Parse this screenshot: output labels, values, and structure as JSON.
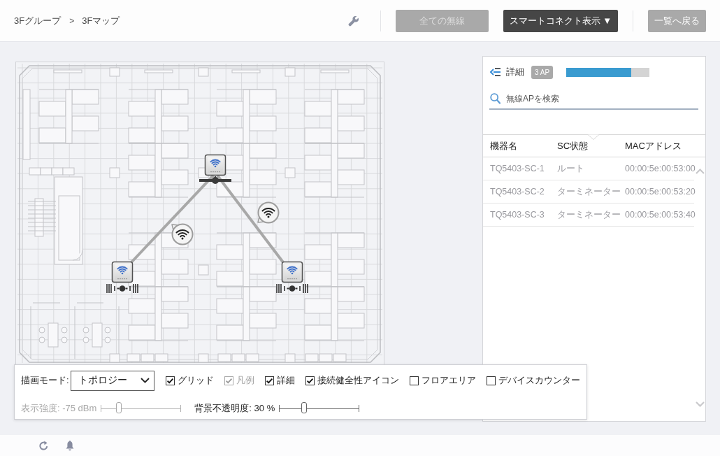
{
  "top_bar": {
    "breadcrumb": [
      "3Fグループ",
      "3Fマップ"
    ],
    "separator": ">",
    "buttons": [
      {
        "label": "全ての無線",
        "kind": "secondary",
        "disabled": true
      },
      {
        "label": "スマートコネクト表示 ▼",
        "kind": "primary",
        "disabled": false
      },
      {
        "label": "一覧へ戻る",
        "kind": "secondary",
        "disabled": false
      }
    ]
  },
  "map": {
    "topology": {
      "kind": "root",
      "children": [
        {
          "kind": "terminator"
        },
        {
          "kind": "terminator"
        }
      ]
    }
  },
  "detail_panel": {
    "title": "詳細",
    "badge": "3 AP",
    "level": 0.78,
    "search": {
      "placeholder": "無線APを検索"
    },
    "table": {
      "columns": [
        "機器名",
        "SC状態",
        "MACアドレス"
      ],
      "rows": [
        {
          "cells": [
            "TQ5403-SC-1",
            "ルート",
            "00:00:5e:00:53:00"
          ],
          "selected": false
        },
        {
          "cells": [
            "TQ5403-SC-2",
            "ターミネーター",
            "00:00:5e:00:53:20"
          ],
          "selected": false
        },
        {
          "cells": [
            "TQ5403-SC-3",
            "ターミネーター",
            "00:00:5e:00:53:40"
          ],
          "selected": false
        }
      ]
    }
  },
  "controls": {
    "mode": {
      "label": "描画モード:",
      "value": "トポロジー"
    },
    "options": [
      {
        "label": "グリッド",
        "checked": true,
        "disabled": false
      },
      {
        "label": "凡例",
        "checked": true,
        "disabled": true
      },
      {
        "label": "詳細",
        "checked": true,
        "disabled": false
      },
      {
        "label": "接続健全性アイコン",
        "checked": true,
        "disabled": false
      },
      {
        "label": "フロアエリア",
        "checked": false,
        "disabled": false
      },
      {
        "label": "デバイスカウンター",
        "checked": false,
        "disabled": false
      }
    ],
    "sliders": [
      {
        "label": "表示強度: -75 dBm",
        "level": 0.22,
        "disabled": true
      },
      {
        "label": "背景不透明度: 30 %",
        "level": 0.31,
        "disabled": false
      }
    ]
  }
}
